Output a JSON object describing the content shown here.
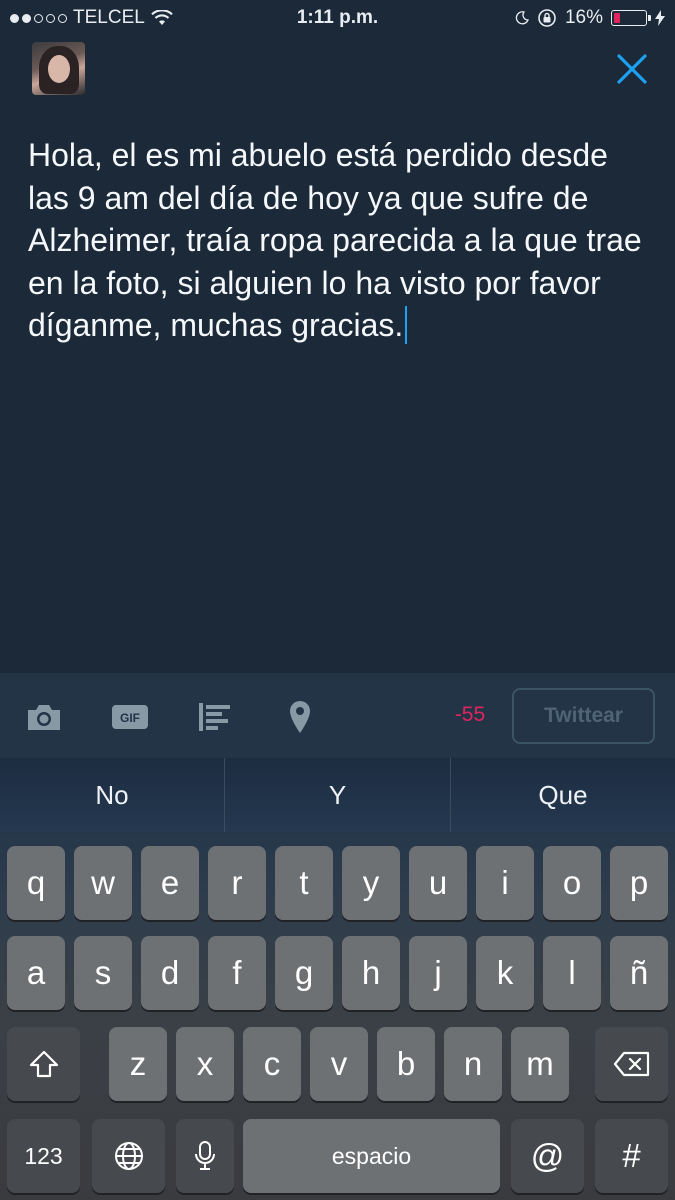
{
  "status_bar": {
    "carrier": "TELCEL",
    "time": "1:11 p.m.",
    "battery": "16%",
    "signal_bars_filled": 2,
    "signal_bars_total": 5
  },
  "compose": {
    "text": "Hola, el es mi abuelo está perdido desde las 9 am del día de hoy ya que sufre de Alzheimer, traía ropa parecida a la que trae en la foto, si alguien lo ha visto por favor díganme, muchas gracias."
  },
  "toolbar": {
    "char_counter": "-55",
    "tweet_label": "Twittear",
    "icons": [
      "camera-icon",
      "gif-icon",
      "poll-icon",
      "location-pin-icon"
    ]
  },
  "keyboard": {
    "suggestions": [
      "No",
      "Y",
      "Que"
    ],
    "row1": [
      "q",
      "w",
      "e",
      "r",
      "t",
      "y",
      "u",
      "i",
      "o",
      "p"
    ],
    "row2": [
      "a",
      "s",
      "d",
      "f",
      "g",
      "h",
      "j",
      "k",
      "l",
      "ñ"
    ],
    "row3": [
      "z",
      "x",
      "c",
      "v",
      "b",
      "n",
      "m"
    ],
    "numbers_key": "123",
    "space_label": "espacio",
    "at_key": "@",
    "hash_key": "#"
  },
  "colors": {
    "background": "#1c2938",
    "accent": "#1da1f2",
    "counter_negative": "#e0245e"
  }
}
